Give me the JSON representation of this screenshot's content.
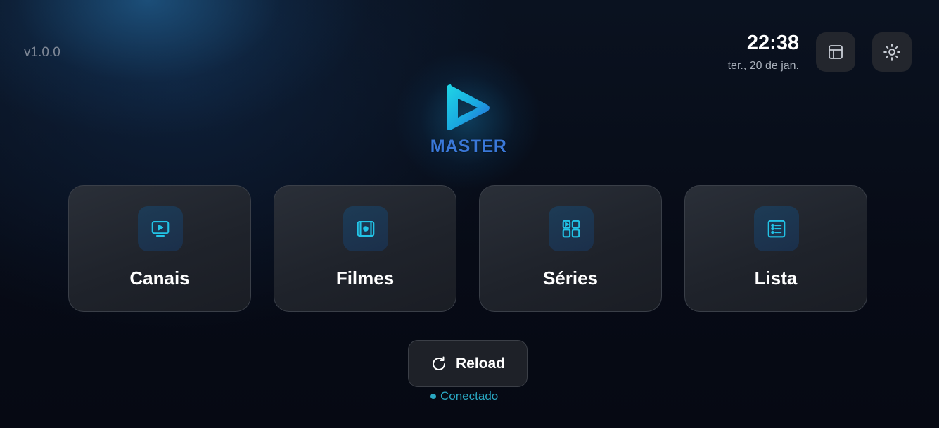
{
  "app": {
    "version": "v1.0.0",
    "logo_text": "MASTER"
  },
  "header": {
    "time": "22:38",
    "date": "ter., 20 de jan.",
    "layout_icon": "layout-icon",
    "theme_icon": "sun-icon"
  },
  "menu": {
    "items": [
      {
        "label": "Canais",
        "icon": "tv-icon"
      },
      {
        "label": "Filmes",
        "icon": "film-icon"
      },
      {
        "label": "Séries",
        "icon": "grid-icon"
      },
      {
        "label": "Lista",
        "icon": "list-icon"
      }
    ]
  },
  "footer": {
    "reload_label": "Reload",
    "status": "Conectado"
  },
  "colors": {
    "accent": "#22c3e6",
    "status": "#2aa7c2",
    "logo_text": "#3a78d8"
  }
}
